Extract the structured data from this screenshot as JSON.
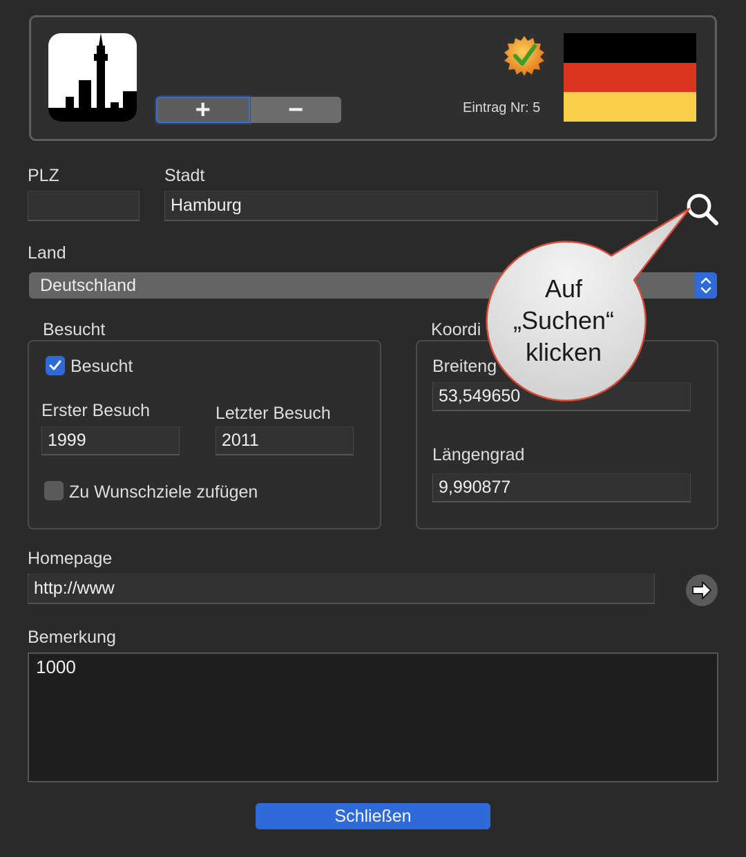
{
  "header": {
    "city_icon": "city-skyline-icon",
    "add_label": "+",
    "remove_label": "−",
    "badge_icon": "verified-badge-icon",
    "entry_label": "Eintrag Nr: 5",
    "flag": {
      "colors": [
        "#000000",
        "#dd3420",
        "#f9ce47"
      ]
    }
  },
  "plz": {
    "label": "PLZ",
    "value": ""
  },
  "stadt": {
    "label": "Stadt",
    "value": "Hamburg"
  },
  "search_icon": "search-icon",
  "land": {
    "label": "Land",
    "value": "Deutschland"
  },
  "besucht": {
    "title": "Besucht",
    "checkbox_label": "Besucht",
    "checked": true,
    "erster_label": "Erster Besuch",
    "erster_value": "1999",
    "letzter_label": "Letzter Besuch",
    "letzter_value": "2011",
    "wunsch_label": "Zu Wunschziele zufügen",
    "wunsch_checked": false
  },
  "koordinaten": {
    "title": "Koordi",
    "breite_label": "Breiteng",
    "breite_value": "53,549650",
    "laenge_label": "Längengrad",
    "laenge_value": "9,990877"
  },
  "callout": {
    "line1": "Auf",
    "line2": "„Suchen“",
    "line3": "klicken"
  },
  "homepage": {
    "label": "Homepage",
    "value": "http://www"
  },
  "bemerkung": {
    "label": "Bemerkung",
    "value": "1000"
  },
  "close_button": "Schließen"
}
